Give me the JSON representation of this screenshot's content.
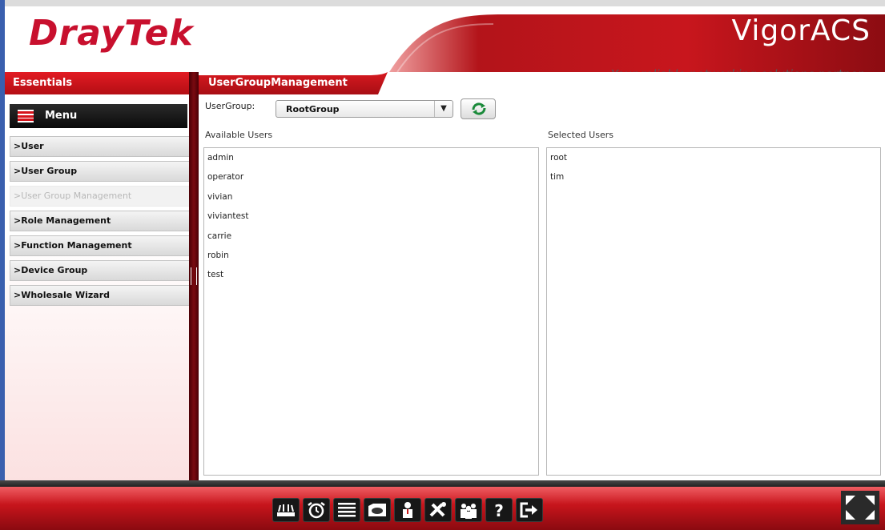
{
  "header": {
    "brand": "DrayTek",
    "product": "VigorACS",
    "tagline": "Your reliable networking solutions partner"
  },
  "sidebar": {
    "section_title": "Essentials",
    "menu_title": "Menu",
    "items": [
      {
        "label": ">User",
        "disabled": false
      },
      {
        "label": ">User Group",
        "disabled": false
      },
      {
        "label": ">User Group Management",
        "disabled": true
      },
      {
        "label": ">Role Management",
        "disabled": false
      },
      {
        "label": ">Function Management",
        "disabled": false
      },
      {
        "label": ">Device Group",
        "disabled": false
      },
      {
        "label": ">Wholesale Wizard",
        "disabled": false
      }
    ]
  },
  "main": {
    "title": "UserGroupManagement",
    "usergroup_label": "UserGroup:",
    "usergroup_value": "RootGroup",
    "available_title": "Available Users",
    "selected_title": "Selected Users",
    "available_users": [
      "admin",
      "operator",
      "vivian",
      "viviantest",
      "carrie",
      "robin",
      "test"
    ],
    "selected_users": [
      "root",
      "tim"
    ]
  },
  "toolbar": {
    "icons": [
      "router-icon",
      "alarm-icon",
      "list-icon",
      "acs-icon",
      "user-icon",
      "tools-icon",
      "users-icon",
      "help-icon",
      "logout-icon"
    ],
    "expand_icon": "expand-icon"
  },
  "colors": {
    "brand_red": "#c8102e",
    "header_red": "#e21b23",
    "divider_dark": "#4a0006"
  }
}
